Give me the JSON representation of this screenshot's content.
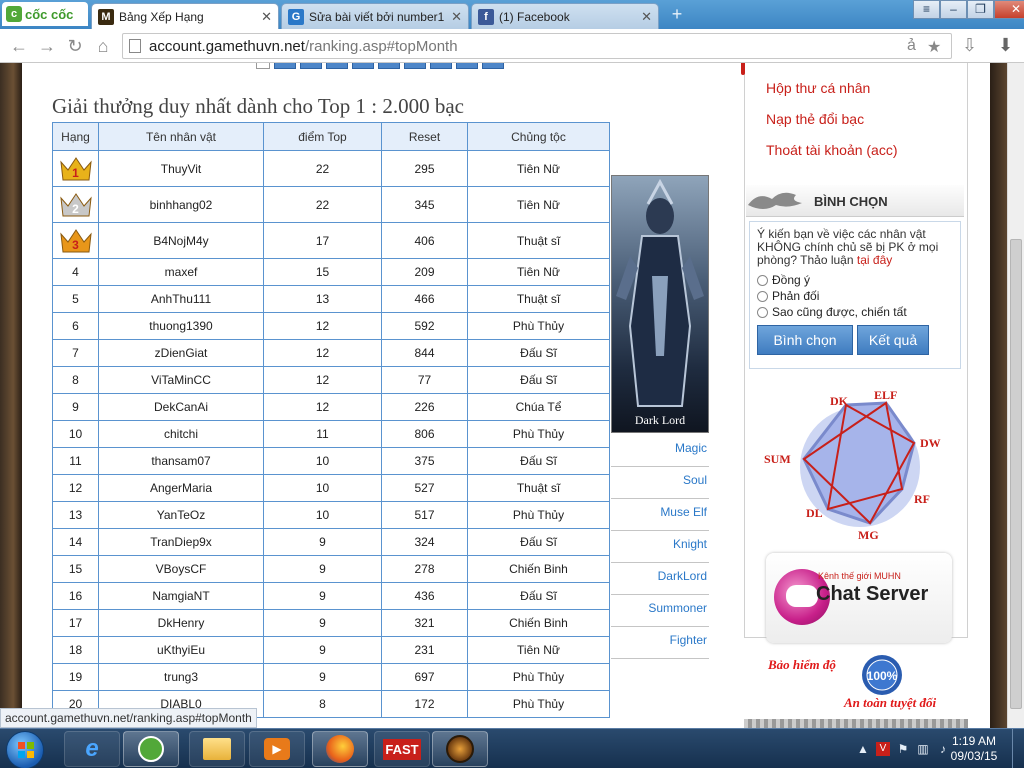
{
  "browser": {
    "brand": "cốc cốc",
    "tabs": [
      {
        "title": "Bảng Xếp Hạng",
        "active": true
      },
      {
        "title": "Sửa bài viết bởi number1 |",
        "active": false
      },
      {
        "title": "(1) Facebook",
        "active": false
      }
    ],
    "url_host": "account.gamethuvn.net",
    "url_path": "/ranking.asp#topMonth",
    "status_url": "account.gamethuvn.net/ranking.asp#topMonth"
  },
  "page": {
    "heading": "Giải thưởng duy nhất dành cho Top 1 : 2.000 bạc",
    "table": {
      "headers": [
        "Hạng",
        "Tên nhân vật",
        "điểm Top",
        "Reset",
        "Chủng tộc"
      ],
      "rows": [
        {
          "rank": "1",
          "name": "ThuyVit",
          "score": "22",
          "reset": "295",
          "race": "Tiên Nữ"
        },
        {
          "rank": "2",
          "name": "binhhang02",
          "score": "22",
          "reset": "345",
          "race": "Tiên Nữ"
        },
        {
          "rank": "3",
          "name": "B4NojM4y",
          "score": "17",
          "reset": "406",
          "race": "Thuật sĩ"
        },
        {
          "rank": "4",
          "name": "maxef",
          "score": "15",
          "reset": "209",
          "race": "Tiên Nữ"
        },
        {
          "rank": "5",
          "name": "AnhThu111",
          "score": "13",
          "reset": "466",
          "race": "Thuật sĩ"
        },
        {
          "rank": "6",
          "name": "thuong1390",
          "score": "12",
          "reset": "592",
          "race": "Phù Thủy"
        },
        {
          "rank": "7",
          "name": "zDienGiat",
          "score": "12",
          "reset": "844",
          "race": "Đấu Sĩ"
        },
        {
          "rank": "8",
          "name": "ViTaMinCC",
          "score": "12",
          "reset": "77",
          "race": "Đấu Sĩ"
        },
        {
          "rank": "9",
          "name": "DekCanAi",
          "score": "12",
          "reset": "226",
          "race": "Chúa Tể"
        },
        {
          "rank": "10",
          "name": "chitchi",
          "score": "11",
          "reset": "806",
          "race": "Phù Thủy"
        },
        {
          "rank": "11",
          "name": "thansam07",
          "score": "10",
          "reset": "375",
          "race": "Đấu Sĩ"
        },
        {
          "rank": "12",
          "name": "AngerMaria",
          "score": "10",
          "reset": "527",
          "race": "Thuật sĩ"
        },
        {
          "rank": "13",
          "name": "YanTeOz",
          "score": "10",
          "reset": "517",
          "race": "Phù Thủy"
        },
        {
          "rank": "14",
          "name": "TranDiep9x",
          "score": "9",
          "reset": "324",
          "race": "Đấu Sĩ"
        },
        {
          "rank": "15",
          "name": "VBoysCF",
          "score": "9",
          "reset": "278",
          "race": "Chiến Binh"
        },
        {
          "rank": "16",
          "name": "NamgiaNT",
          "score": "9",
          "reset": "436",
          "race": "Đấu Sĩ"
        },
        {
          "rank": "17",
          "name": "DkHenry",
          "score": "9",
          "reset": "321",
          "race": "Chiến Binh"
        },
        {
          "rank": "18",
          "name": "uKthyiEu",
          "score": "9",
          "reset": "231",
          "race": "Tiên Nữ"
        },
        {
          "rank": "19",
          "name": "trung3",
          "score": "9",
          "reset": "697",
          "race": "Phù Thủy"
        },
        {
          "rank": "20",
          "name": "DIABL0",
          "score": "8",
          "reset": "172",
          "race": "Phù Thủy"
        }
      ]
    },
    "character_label": "Dark Lord",
    "class_links": [
      "Magic",
      "Soul",
      "Muse Elf",
      "Knight",
      "DarkLord",
      "Summoner",
      "Fighter"
    ]
  },
  "sidebar": {
    "menu": [
      "Hộp thư cá nhân",
      "Nạp thẻ đổi bạc",
      "Thoát tài khoản (acc)"
    ],
    "vote_title": "BÌNH CHỌN",
    "vote_question": "Ý kiến bạn về việc các nhân vật KHÔNG chính chủ sẽ bị PK ở mọi phòng? Thảo luận",
    "vote_link": "tại đây",
    "vote_options": [
      "Đồng ý",
      "Phản đối",
      "Sao cũng được, chiến tất"
    ],
    "vote_button": "Bình chọn",
    "result_button": "Kết quả",
    "diagram_labels": [
      "DK",
      "ELF",
      "DW",
      "RF",
      "MG",
      "DL",
      "SUM"
    ],
    "chat_sub": "Kênh thế giới MUHN",
    "chat_main": "Chat Server",
    "badge_top": "Bảo hiểm độ",
    "badge_bottom": "An toàn tuyệt đối",
    "badge_percent": "100%"
  },
  "taskbar": {
    "time": "1:19 AM",
    "date": "09/03/15",
    "fast_label": "FAST"
  },
  "colors": {
    "table_border": "#5a93cf",
    "link_red": "#c8201a",
    "link_blue": "#2a78c8"
  }
}
